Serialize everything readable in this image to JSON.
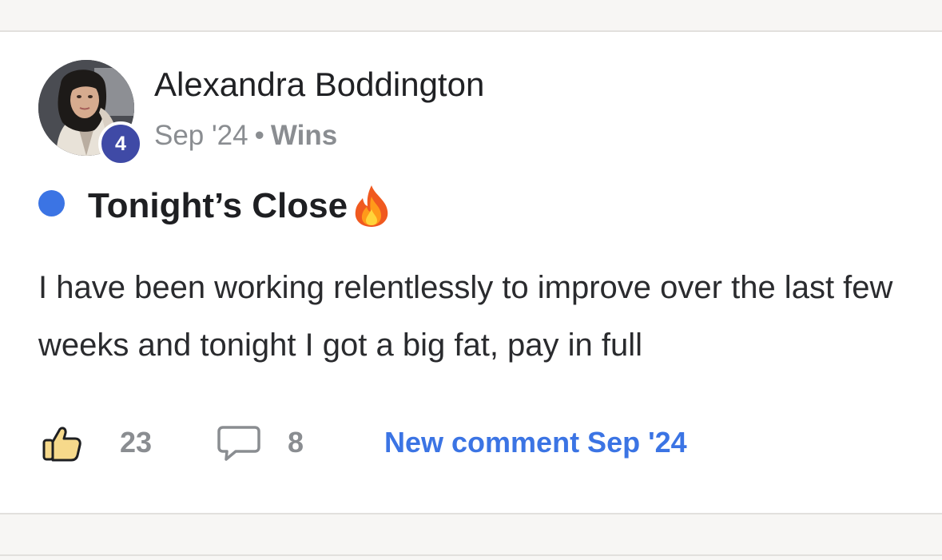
{
  "post": {
    "author": {
      "name": "Alexandra Boddington",
      "level": "4"
    },
    "meta": {
      "date": "Sep '24",
      "separator": "•",
      "category": "Wins"
    },
    "title": "Tonight’s Close",
    "title_icon": "fire-icon",
    "body": "I have been working relentlessly to improve over the last few weeks and tonight I got a big fat, pay in full",
    "actions": {
      "like_icon": "thumbs-up-icon",
      "like_count": "23",
      "comment_icon": "comment-bubble-icon",
      "comment_count": "8",
      "new_comment_label": "New comment Sep '24"
    }
  },
  "colors": {
    "accent": "#3b74e4",
    "level_badge": "#3f4aa6",
    "muted_text": "#8a8d91",
    "page_background": "#f7f6f4"
  }
}
